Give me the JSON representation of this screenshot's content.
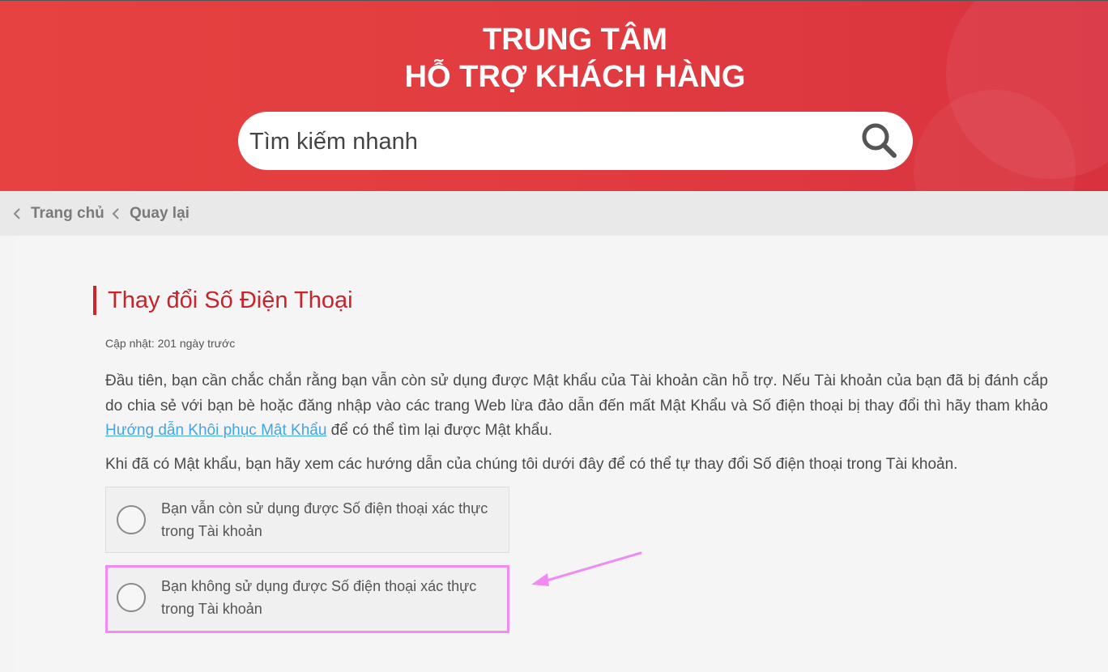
{
  "header": {
    "title_line1": "TRUNG TÂM",
    "title_line2": "HỖ TRỢ KHÁCH HÀNG",
    "accent_color": "#e23d40"
  },
  "search": {
    "placeholder": "Tìm kiếm nhanh",
    "icon": "search-icon"
  },
  "breadcrumb": {
    "home": "Trang chủ",
    "back": "Quay lại",
    "icon": "chevron-left-icon"
  },
  "article": {
    "title": "Thay đổi Số Điện Thoại",
    "updated": "Cập nhật: 201 ngày trước",
    "para1_before": "Đầu tiên, bạn cần chắc chắn rằng bạn vẫn còn sử dụng được Mật khẩu của Tài khoản cần hỗ trợ. Nếu Tài khoản của bạn đã bị đánh cắp do chia sẻ với bạn bè hoặc đăng nhập vào các trang Web lừa đảo dẫn đến mất Mật Khẩu và Số điện thoại bị thay đổi thì hãy tham khảo ",
    "para1_link": "Hướng dẫn Khôi phục Mật Khẩu",
    "para1_after": " để có thể tìm lại được Mật khẩu.",
    "para2": "Khi đã có Mật khẩu, bạn hãy xem các hướng dẫn của chúng tôi dưới đây để có thể tự thay đổi Số điện thoại trong Tài khoản.",
    "options": [
      {
        "label": "Bạn vẫn còn sử dụng được Số điện thoại xác thực trong Tài khoản",
        "selected": false
      },
      {
        "label": "Bạn không sử dụng được Số điện thoại xác thực trong Tài khoản",
        "selected": false,
        "highlighted": true
      }
    ],
    "highlight_color": "#f18bf1"
  }
}
